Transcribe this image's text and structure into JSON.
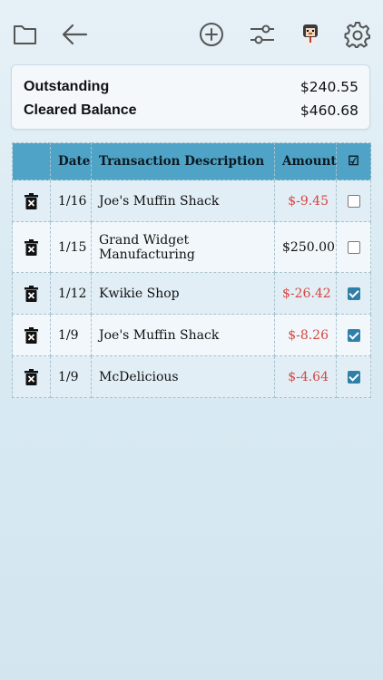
{
  "toolbar": {
    "icons": [
      "folder-icon",
      "back-arrow-icon",
      "add-circle-icon",
      "sliders-icon",
      "avatar",
      "gear-icon"
    ]
  },
  "summary": {
    "outstanding_label": "Outstanding",
    "outstanding_value": "$240.55",
    "cleared_label": "Cleared Balance",
    "cleared_value": "$460.68"
  },
  "table": {
    "headers": {
      "delete": "",
      "date": "Date",
      "description": "Transaction Description",
      "amount": "Amount",
      "cleared": "☑"
    },
    "rows": [
      {
        "date": "1/16",
        "description": "Joe's Muffin Shack",
        "amount": "$-9.45",
        "negative": true,
        "cleared": false
      },
      {
        "date": "1/15",
        "description": "Grand Widget Manufacturing",
        "amount": "$250.00",
        "negative": false,
        "cleared": false
      },
      {
        "date": "1/12",
        "description": "Kwikie Shop",
        "amount": "$-26.42",
        "negative": true,
        "cleared": true
      },
      {
        "date": "1/9",
        "description": "Joe's Muffin Shack",
        "amount": "$-8.26",
        "negative": true,
        "cleared": true
      },
      {
        "date": "1/9",
        "description": "McDelicious",
        "amount": "$-4.64",
        "negative": true,
        "cleared": true
      }
    ]
  },
  "colors": {
    "header_bg": "#4fa3c6",
    "negative": "#d64541",
    "checked": "#2f7fa8"
  }
}
